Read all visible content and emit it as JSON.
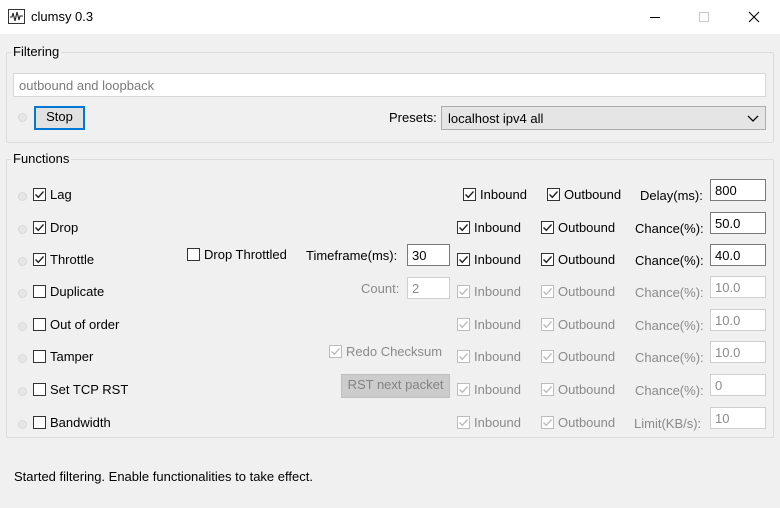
{
  "window": {
    "title": "clumsy 0.3"
  },
  "filtering": {
    "group_title": "Filtering",
    "filter_value": "outbound and loopback",
    "stop_label": "Stop",
    "presets_label": "Presets:",
    "preset_selected": "localhost ipv4 all"
  },
  "functions": {
    "group_title": "Functions",
    "rows": [
      {
        "name": "Lag",
        "checked": true,
        "inbound": "Inbound",
        "inbound_checked": true,
        "outbound": "Outbound",
        "outbound_checked": true,
        "param_label": "Delay(ms):",
        "param_value": "800",
        "enabled": true
      },
      {
        "name": "Drop",
        "checked": true,
        "inbound": "Inbound",
        "inbound_checked": true,
        "outbound": "Outbound",
        "outbound_checked": true,
        "param_label": "Chance(%):",
        "param_value": "50.0",
        "enabled": true
      },
      {
        "name": "Throttle",
        "checked": true,
        "inbound": "Inbound",
        "inbound_checked": true,
        "outbound": "Outbound",
        "outbound_checked": true,
        "param_label": "Chance(%):",
        "param_value": "40.0",
        "enabled": true
      },
      {
        "name": "Duplicate",
        "checked": false,
        "inbound": "Inbound",
        "inbound_checked": true,
        "outbound": "Outbound",
        "outbound_checked": true,
        "param_label": "Chance(%):",
        "param_value": "10.0",
        "enabled": false
      },
      {
        "name": "Out of order",
        "checked": false,
        "inbound": "Inbound",
        "inbound_checked": true,
        "outbound": "Outbound",
        "outbound_checked": true,
        "param_label": "Chance(%):",
        "param_value": "10.0",
        "enabled": false
      },
      {
        "name": "Tamper",
        "checked": false,
        "inbound": "Inbound",
        "inbound_checked": true,
        "outbound": "Outbound",
        "outbound_checked": true,
        "param_label": "Chance(%):",
        "param_value": "10.0",
        "enabled": false
      },
      {
        "name": "Set TCP RST",
        "checked": false,
        "inbound": "Inbound",
        "inbound_checked": true,
        "outbound": "Outbound",
        "outbound_checked": true,
        "param_label": "Chance(%):",
        "param_value": "0",
        "enabled": false
      },
      {
        "name": "Bandwidth",
        "checked": false,
        "inbound": "Inbound",
        "inbound_checked": true,
        "outbound": "Outbound",
        "outbound_checked": true,
        "param_label": "Limit(KB/s):",
        "param_value": "10",
        "enabled": false
      }
    ],
    "throttle_extra": {
      "drop_throttled_label": "Drop Throttled",
      "drop_throttled_checked": false,
      "timeframe_label": "Timeframe(ms):",
      "timeframe_value": "30"
    },
    "duplicate_extra": {
      "count_label": "Count:",
      "count_value": "2"
    },
    "tamper_extra": {
      "redo_checksum_label": "Redo Checksum",
      "redo_checksum_checked": true
    },
    "tcprst_extra": {
      "rst_button_label": "RST next packet"
    }
  },
  "status": {
    "text": "Started filtering. Enable functionalities to take effect."
  },
  "icons": {
    "app": "waveform-app-icon",
    "minimize": "minimize-icon",
    "maximize": "maximize-icon",
    "close": "close-icon",
    "dropdown": "chevron-down-icon",
    "checkmark": "checkmark-icon"
  }
}
